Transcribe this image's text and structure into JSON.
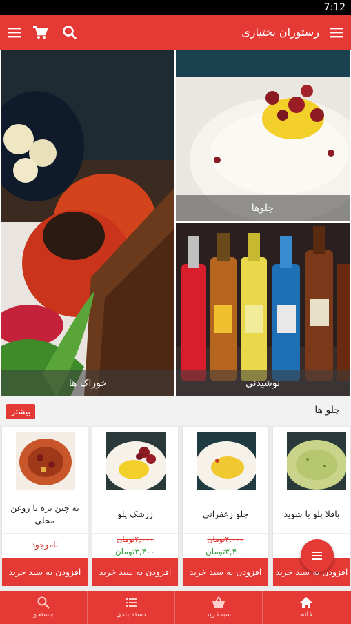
{
  "status_bar": {
    "time": "7:12"
  },
  "app_bar": {
    "title": "رستوران بختیاری"
  },
  "categories": [
    {
      "label": "خوراک ها"
    },
    {
      "label": "چلوها"
    },
    {
      "label": "نوشیدنی"
    }
  ],
  "section": {
    "title": "چلو ها",
    "more_label": "بیشتر"
  },
  "products": [
    {
      "name": "ته چین بره با روغن محلی",
      "status": "ناموجود",
      "add_label": "افزودن به سبد خرید"
    },
    {
      "name": "زرشک پلو",
      "old_price": "۴,۰۰۰تومان",
      "new_price": "۳,۴۰۰تومان",
      "add_label": "افزودن به سبد خرید"
    },
    {
      "name": "چلو زعفرانی",
      "old_price": "۴,۰۰۰تومان",
      "new_price": "۳,۴۰۰تومان",
      "add_label": "افزودن به سبد خرید"
    },
    {
      "name": "باقلا پلو با شوید",
      "add_label": "افزودن به سبد خرید"
    }
  ],
  "bottom_nav": [
    {
      "label": "جستجو"
    },
    {
      "label": "دسته بندی"
    },
    {
      "label": "سبدخرید"
    },
    {
      "label": "خانه"
    }
  ],
  "colors": {
    "primary": "#e53935",
    "price_new": "#2e9e3a",
    "status_bar": "#000000"
  }
}
